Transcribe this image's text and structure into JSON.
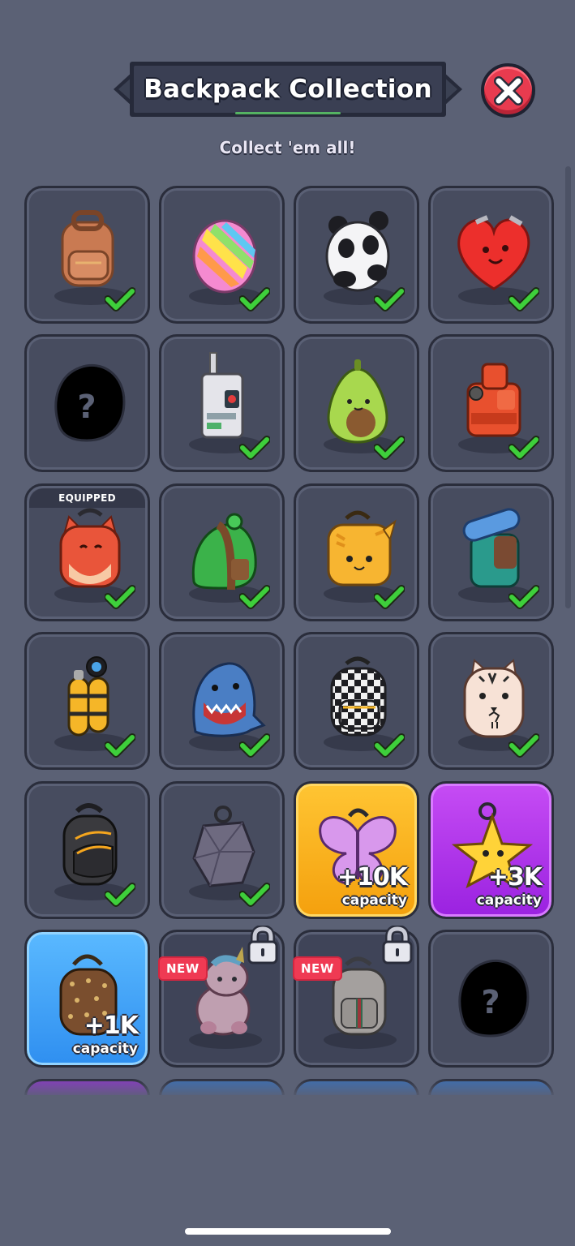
{
  "header": {
    "title": "Backpack Collection",
    "subtitle": "Collect 'em all!",
    "close_icon": "close-x-icon"
  },
  "colors": {
    "background": "#5b6175",
    "tile": "#474c5f",
    "check": "#3ecf3b",
    "close": "#e83b4f",
    "gold_tile": "#ffc533",
    "purple_tile": "#b23aec",
    "blue_tile": "#47a6fb",
    "new_badge": "#ef3a53"
  },
  "grid": {
    "equipped_label": "EQUIPPED",
    "new_label": "NEW",
    "capacity_label": "capacity",
    "items": [
      {
        "name": "brown-backpack",
        "owned": true
      },
      {
        "name": "rainbow-backpack",
        "owned": true
      },
      {
        "name": "panda-backpack",
        "owned": true
      },
      {
        "name": "heart-backpack",
        "owned": true
      },
      {
        "name": "mystery-backpack",
        "owned": false
      },
      {
        "name": "robot-backpack",
        "owned": true
      },
      {
        "name": "avocado-backpack",
        "owned": true
      },
      {
        "name": "orange-hiking-backpack",
        "owned": true
      },
      {
        "name": "fox-backpack",
        "owned": true,
        "equipped": true
      },
      {
        "name": "green-backpack",
        "owned": true
      },
      {
        "name": "tiger-cat-backpack",
        "owned": true
      },
      {
        "name": "camping-backpack",
        "owned": true
      },
      {
        "name": "scuba-tank-backpack",
        "owned": true
      },
      {
        "name": "shark-backpack",
        "owned": true
      },
      {
        "name": "checkered-backpack",
        "owned": true
      },
      {
        "name": "white-tiger-backpack",
        "owned": true
      },
      {
        "name": "black-sling-backpack",
        "owned": true
      },
      {
        "name": "crystal-backpack",
        "owned": true
      },
      {
        "name": "butterfly-backpack",
        "bonus": "+10K"
      },
      {
        "name": "star-backpack",
        "bonus": "+3K"
      },
      {
        "name": "designer-backpack",
        "bonus": "+1K"
      },
      {
        "name": "unicorn-backpack",
        "locked": true,
        "new": true
      },
      {
        "name": "luxury-backpack",
        "locked": true,
        "new": true
      },
      {
        "name": "mystery-backpack-2",
        "owned": false
      }
    ]
  }
}
